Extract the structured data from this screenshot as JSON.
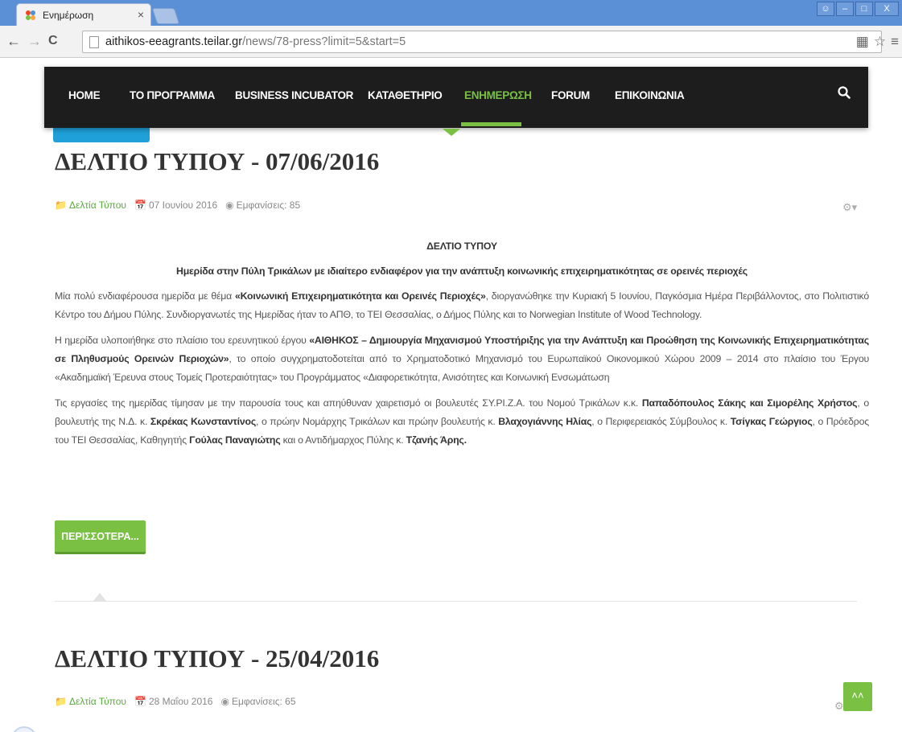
{
  "browser": {
    "tab_title": "Ενημέρωση",
    "tab_close": "×",
    "url_host": "aithikos-eeagrants.teilar.gr",
    "url_path": "/news/78-press?limit=5&start=5",
    "win_min": "–",
    "win_max": "□",
    "win_close": "X",
    "back": "←",
    "forward": "→",
    "reload": "C"
  },
  "nav": {
    "items": [
      {
        "label": "HOME"
      },
      {
        "label": "ΤΟ ΠΡΟΓΡΑΜΜΑ"
      },
      {
        "label": "BUSINESS INCUBATOR"
      },
      {
        "label": "ΚΑΤΑΘΕΤΗΡΙΟ"
      },
      {
        "label": "ΕΝΗΜΕΡΩΣΗ"
      },
      {
        "label": "FORUM"
      },
      {
        "label": "ΕΠΙΚΟΙΝΩΝΙΑ"
      }
    ],
    "active_index": 4
  },
  "articles": [
    {
      "title": "ΔΕΛΤΙΟ ΤΥΠΟΥ - 07/06/2016",
      "category": "Δελτία Τύπου",
      "date": "07 Ιουνίου 2016",
      "views": "Εμφανίσεις: 85",
      "heading": "ΔΕΛΤΙΟ ΤΥΠΟΥ",
      "subheading": "Ημερίδα στην Πύλη Τρικάλων με ιδιαίτερο ενδιαφέρον για την ανάπτυξη κοινωνικής επιχειρηματικότητας σε ορεινές περιοχές",
      "p1": {
        "a": "Μία πολύ ενδιαφέρουσα ημερίδα με θέμα ",
        "b": "«Κοινωνική Επιχειρηματικότητα και Ορεινές Περιοχές»",
        "c": ", διοργανώθηκε την Κυριακή 5 Ιουνίου, Παγκόσμια Ημέρα Περιβάλλοντος, στο Πολιτιστικό Κέντρο του Δήμου Πύλης. Συνδιοργανωτές της Ημερίδας ήταν το ΑΠΘ, το ΤΕΙ Θεσσαλίας, ο Δήμος Πύλης και το Norwegian Institute of Wood Technology."
      },
      "p2": {
        "a": "Η ημερίδα υλοποιήθηκε στο πλαίσιο του ερευνητικού έργου ",
        "b": "«ΑΙΘΗΚΟΣ – Δημιουργία Μηχανισμού Υποστήριξης για την Ανάπτυξη και Προώθηση της Κοινωνικής Επιχειρηματικότητας σε Πληθυσμούς Ορεινών Περιοχών»",
        "c": ", το οποίο συγχρηματοδοτείται από το Χρηματοδοτικό Μηχανισμό του Ευρωπαϊκού Οικονομικού Χώρου 2009 – 2014 στο πλαίσιο του Έργου «Ακαδημαϊκή Έρευνα στους Τομείς Προτεραιότητας» του Προγράμματος «Διαφορετικότητα, Ανισότητες και Κοινωνική Ενσωμάτωση"
      },
      "p3": {
        "t1": "Τις εργασίες της ημερίδας τίμησαν με την παρουσία τους και απηύθυναν χαιρετισμό οι βουλευτές ΣΥ.ΡΙ.Ζ.Α. του Νομού Τρικάλων κ.κ. ",
        "b1": "Παπαδόπουλος Σάκης και Σιμορέλης Χρήστος",
        "t2": ", ο βουλευτής της Ν.Δ. κ. ",
        "b2": "Σκρέκας Κωνσταντίνος",
        "t3": ", ο πρώην Νομάρχης Τρικάλων και πρώην βουλευτής κ. ",
        "b3": "Βλαχογιάννης Ηλίας",
        "t4": ",   ο Περιφερειακός Σύμβουλος κ. ",
        "b4": "Τσίγκας Γεώργιος",
        "t5": ", ο Πρόεδρος του ΤΕΙ Θεσσαλίας, Καθηγητής ",
        "b5": "Γούλας Παναγιώτης",
        "t6": " και ο Αντιδήμαρχος Πύλης κ. ",
        "b6": "Τζανής Άρης."
      },
      "more_label": "ΠΕΡΙΣΣΟΤΕΡΑ..."
    },
    {
      "title": "ΔΕΛΤΙΟ ΤΥΠΟΥ - 25/04/2016",
      "category": "Δελτία Τύπου",
      "date": "28 Μαΐου 2016",
      "views": "Εμφανίσεις: 65"
    }
  ],
  "colors": {
    "accent_green": "#7ac143",
    "press_blue": "#1fa0d8",
    "nav_bg": "#1d1d1d"
  },
  "icons": {
    "folder": "folder-icon",
    "calendar": "calendar-icon",
    "eye": "eye-icon",
    "gear": "gear-icon",
    "search": "search-icon",
    "scroll_top": "double-chevron-up-icon"
  }
}
